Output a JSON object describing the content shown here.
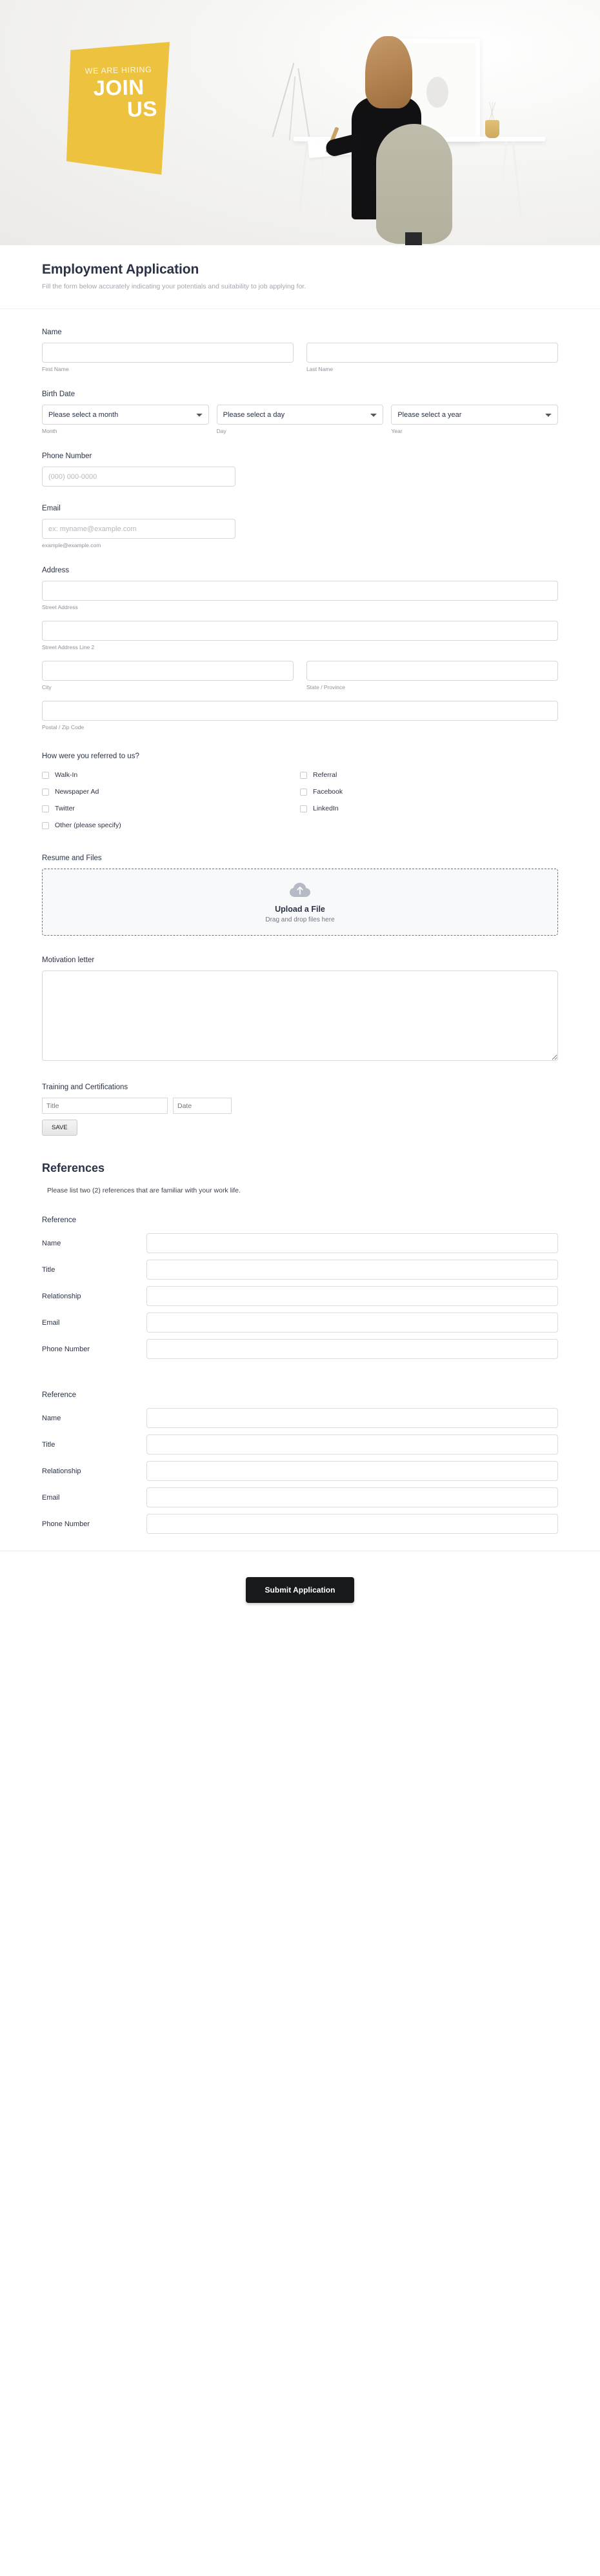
{
  "banner": {
    "tagline": "WE ARE HIRING",
    "headline_line1": "JOIN",
    "headline_line2": "US"
  },
  "header": {
    "title": "Employment Application",
    "subtitle": "Fill the form below accurately indicating your potentials and suitability to job applying for."
  },
  "name_section": {
    "label": "Name",
    "first_sub": "First Name",
    "last_sub": "Last Name",
    "first_value": "",
    "last_value": ""
  },
  "birth_date": {
    "label": "Birth Date",
    "month_selected": "Please select a month",
    "day_selected": "Please select a day",
    "year_selected": "Please select a year",
    "month_sub": "Month",
    "day_sub": "Day",
    "year_sub": "Year"
  },
  "phone": {
    "label": "Phone Number",
    "placeholder": "(000) 000-0000",
    "value": ""
  },
  "email": {
    "label": "Email",
    "placeholder": "ex: myname@example.com",
    "hint": "example@example.com",
    "value": ""
  },
  "address": {
    "label": "Address",
    "street_sub": "Street Address",
    "street2_sub": "Street Address Line 2",
    "city_sub": "City",
    "state_sub": "State / Province",
    "postal_sub": "Postal / Zip Code",
    "street_value": "",
    "street2_value": "",
    "city_value": "",
    "state_value": "",
    "postal_value": ""
  },
  "referral": {
    "label": "How were you referred to us?",
    "left_options": [
      "Walk-In",
      "Newspaper Ad",
      "Twitter",
      "Other (please specify)"
    ],
    "right_options": [
      "Referral",
      "Facebook",
      "LinkedIn"
    ]
  },
  "resume": {
    "label": "Resume and Files",
    "upload_title": "Upload a File",
    "upload_sub": "Drag and drop files here",
    "icon": "cloud-upload-icon"
  },
  "motivation": {
    "label": "Motivation letter",
    "value": ""
  },
  "training": {
    "label": "Training and Certifications",
    "title_placeholder": "Title",
    "date_placeholder": "Date",
    "title_value": "",
    "date_value": "",
    "save_label": "SAVE"
  },
  "references": {
    "heading": "References",
    "note": "Please list two (2) references that are familiar with your work life.",
    "group_label": "Reference",
    "row_labels": [
      "Name",
      "Title",
      "Relationship",
      "Email",
      "Phone Number"
    ],
    "blocks": [
      {
        "name": "",
        "title": "",
        "relationship": "",
        "email": "",
        "phone": ""
      },
      {
        "name": "",
        "title": "",
        "relationship": "",
        "email": "",
        "phone": ""
      }
    ]
  },
  "submit": {
    "label": "Submit Application"
  },
  "colors": {
    "accent_yellow": "#ecc23f",
    "title_navy": "#2b3246",
    "submit_dark": "#18191b",
    "border_gray": "#d4d7dc"
  }
}
